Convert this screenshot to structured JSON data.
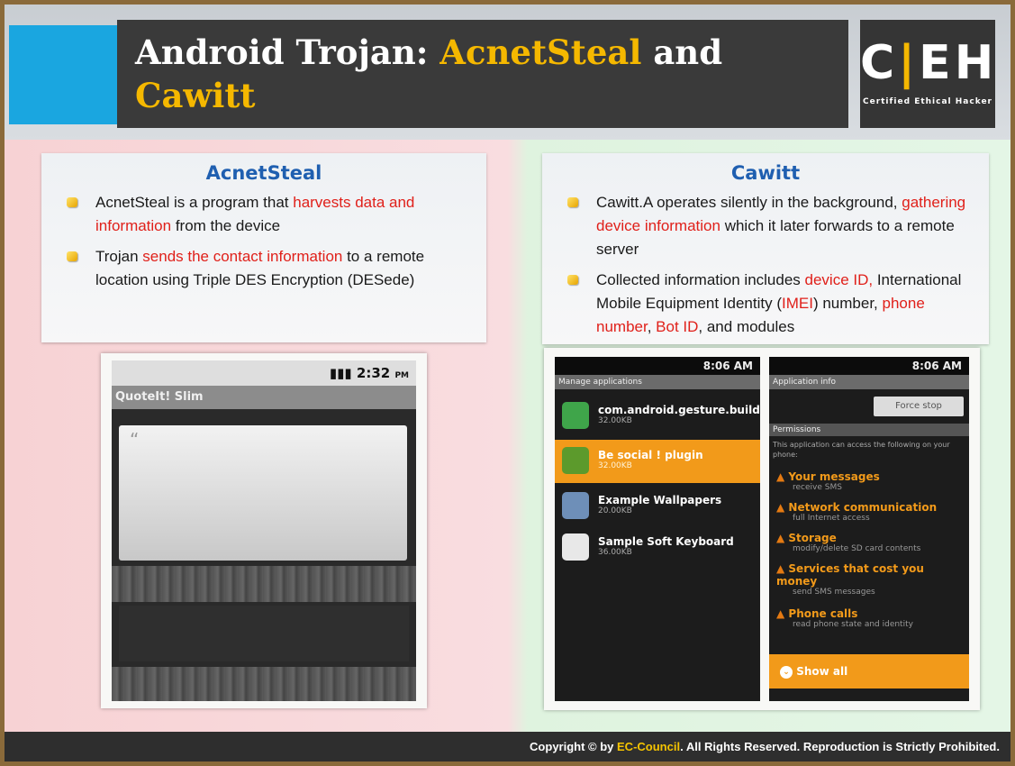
{
  "header": {
    "title_part1": "Android Trojan: ",
    "title_hl1": "AcnetSteal",
    "title_part2": " and",
    "title_hl2": "Cawitt",
    "logo_text_left": "C",
    "logo_text_right": "EH",
    "logo_sub": "Certified  Ethical  Hacker"
  },
  "acnetsteal": {
    "heading": "AcnetSteal",
    "b1_a": "AcnetSteal is a program that ",
    "b1_red": "harvests data and information",
    "b1_b": " from the device",
    "b2_a": "Trojan ",
    "b2_red": "sends the contact information",
    "b2_b": " to a remote location using Triple DES Encryption (DESede)"
  },
  "cawitt": {
    "heading": "Cawitt",
    "b1_a": "Cawitt.A operates silently in the background, ",
    "b1_red": "gathering device information",
    "b1_b": " which it later forwards to a remote server",
    "b2_a": "Collected information includes ",
    "b2_red1": "device ID,",
    "b2_b": " International Mobile Equipment Identity (",
    "b2_red2": "IMEI",
    "b2_c": ") number, ",
    "b2_red3": "phone number",
    "b2_d": ", ",
    "b2_red4": "Bot ID",
    "b2_e": ", and modules"
  },
  "screen1": {
    "time": "2:32",
    "time_suffix": "PM",
    "app_title": "QuoteIt! Slim",
    "quote_mark": "“"
  },
  "screen2": {
    "time": "8:06 AM",
    "bar_title": "Manage applications",
    "apps": [
      {
        "name": "com.android.gesture.builder",
        "size": "32.00KB"
      },
      {
        "name": "Be social ! plugin",
        "size": "32.00KB"
      },
      {
        "name": "Example Wallpapers",
        "size": "20.00KB"
      },
      {
        "name": "Sample Soft Keyboard",
        "size": "36.00KB"
      }
    ]
  },
  "screen3": {
    "time": "8:06 AM",
    "bar_title": "Application info",
    "force_stop": "Force stop",
    "permissions_label": "Permissions",
    "perm_intro": "This application can access the following on your phone:",
    "perms": [
      {
        "name": "Your messages",
        "desc": "receive SMS"
      },
      {
        "name": "Network communication",
        "desc": "full Internet access"
      },
      {
        "name": "Storage",
        "desc": "modify/delete SD card contents"
      },
      {
        "name": "Services that cost you money",
        "desc": "send SMS messages"
      },
      {
        "name": "Phone calls",
        "desc": "read phone state and identity"
      }
    ],
    "show_all": "Show all"
  },
  "footer": {
    "copy_a": "Copyright © by ",
    "brand": "EC-Council",
    "copy_b": ". All Rights Reserved. Reproduction is Strictly Prohibited."
  },
  "colors": {
    "accent_yellow": "#f5b800",
    "heading_blue": "#1f5fb0",
    "highlight_red": "#e0201a",
    "android_orange": "#f29a1a"
  }
}
